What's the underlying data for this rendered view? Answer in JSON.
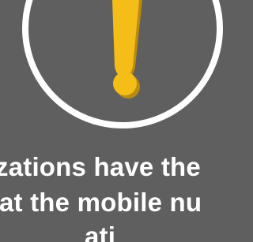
{
  "message": {
    "line_1": "zations have the",
    "line_2": "at the mobile nu",
    "line_3": "ati"
  },
  "icons": {
    "alert": "exclamation-in-circle-icon"
  },
  "colors": {
    "background": "#5f5f5f",
    "circle": "#ffffff",
    "exclamation": "#f5bd18",
    "text": "#ffffff"
  }
}
